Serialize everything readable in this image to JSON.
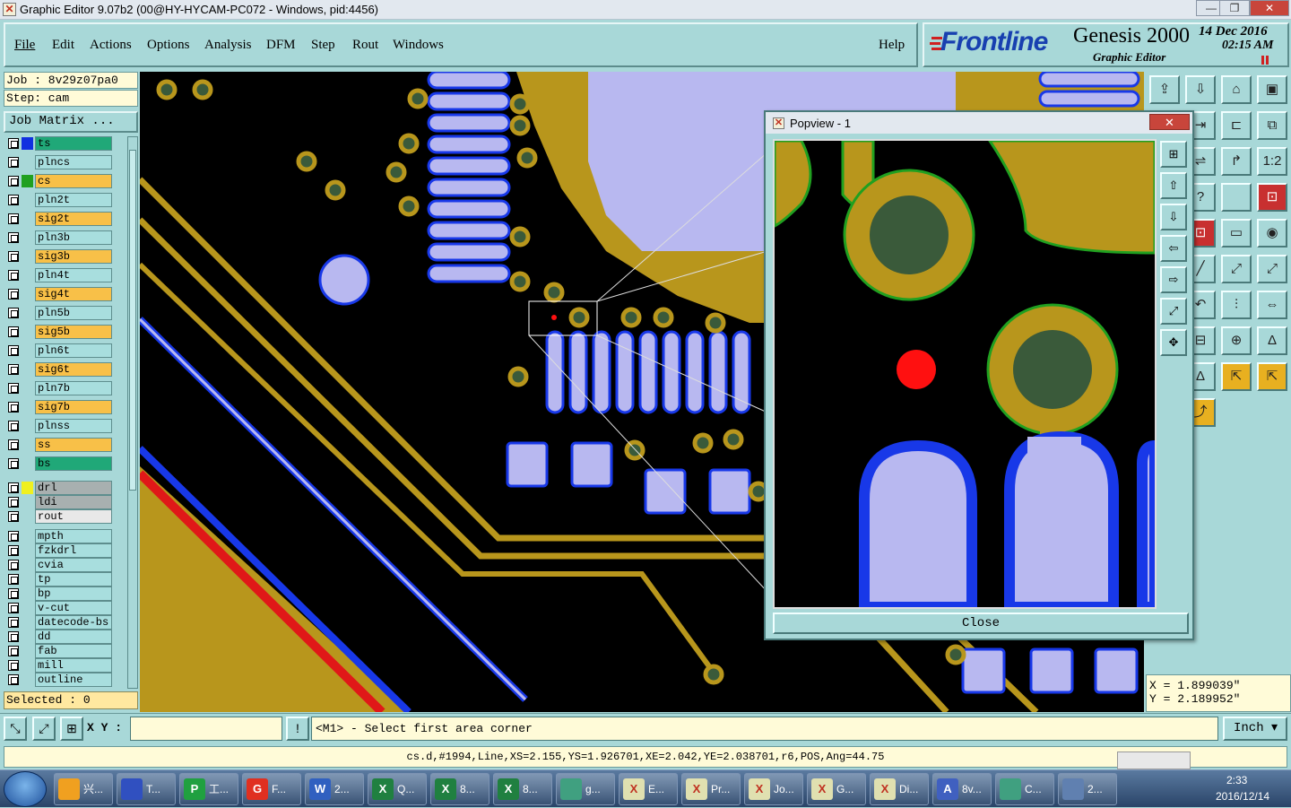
{
  "window": {
    "title": "Graphic Editor 9.07b2 (00@HY-HYCAM-PC072 - Windows, pid:4456)",
    "min": "—",
    "max": "❐",
    "close": "✕"
  },
  "menu": {
    "items": [
      "File",
      "Edit",
      "Actions",
      "Options",
      "Analysis",
      "DFM",
      "Step",
      "Rout",
      "Windows"
    ],
    "help": "Help"
  },
  "brand": {
    "logo": "Frontline",
    "product": "Genesis 2000",
    "subtitle": "Graphic Editor",
    "date": "14 Dec 2016",
    "time": "02:15 AM"
  },
  "job": {
    "job": "Job : 8v29z07pa0",
    "step": "Step: cam",
    "matrix_button": "Job Matrix ..."
  },
  "layers": [
    {
      "name": "ts",
      "color": "#1030e0",
      "bg": "#20a878"
    },
    {
      "name": "plncs",
      "color": "",
      "bg": "#a8dede"
    },
    {
      "name": "cs",
      "color": "#20a020",
      "bg": "#f8c048"
    },
    {
      "name": "pln2t",
      "color": "",
      "bg": "#a8dede"
    },
    {
      "name": "sig2t",
      "color": "",
      "bg": "#f8c048"
    },
    {
      "name": "pln3b",
      "color": "",
      "bg": "#a8dede"
    },
    {
      "name": "sig3b",
      "color": "",
      "bg": "#f8c048"
    },
    {
      "name": "pln4t",
      "color": "",
      "bg": "#a8dede"
    },
    {
      "name": "sig4t",
      "color": "",
      "bg": "#f8c048"
    },
    {
      "name": "pln5b",
      "color": "",
      "bg": "#a8dede"
    },
    {
      "name": "sig5b",
      "color": "",
      "bg": "#f8c048"
    },
    {
      "name": "pln6t",
      "color": "",
      "bg": "#a8dede"
    },
    {
      "name": "sig6t",
      "color": "",
      "bg": "#f8c048"
    },
    {
      "name": "pln7b",
      "color": "",
      "bg": "#a8dede"
    },
    {
      "name": "sig7b",
      "color": "",
      "bg": "#f8c048"
    },
    {
      "name": "plnss",
      "color": "",
      "bg": "#a8dede"
    },
    {
      "name": "ss",
      "color": "",
      "bg": "#f8c048"
    },
    {
      "name": "bs",
      "color": "",
      "bg": "#20a878"
    },
    {
      "name": "drl",
      "color": "#f0f020",
      "bg": "#a8b0b0"
    },
    {
      "name": "ldi",
      "color": "",
      "bg": "#a8b0b0"
    },
    {
      "name": "rout",
      "color": "",
      "bg": "#e8e8e8"
    },
    {
      "name": "mpth",
      "color": "",
      "bg": "#a8dede"
    },
    {
      "name": "fzkdrl",
      "color": "",
      "bg": "#a8dede"
    },
    {
      "name": "cvia",
      "color": "",
      "bg": "#a8dede"
    },
    {
      "name": "tp",
      "color": "",
      "bg": "#a8dede"
    },
    {
      "name": "bp",
      "color": "",
      "bg": "#a8dede"
    },
    {
      "name": "v-cut",
      "color": "",
      "bg": "#a8dede"
    },
    {
      "name": "datecode-bs",
      "color": "",
      "bg": "#a8dede"
    },
    {
      "name": "dd",
      "color": "",
      "bg": "#a8dede"
    },
    {
      "name": "fab",
      "color": "",
      "bg": "#a8dede"
    },
    {
      "name": "mill",
      "color": "",
      "bg": "#a8dede"
    },
    {
      "name": "outline",
      "color": "",
      "bg": "#a8dede"
    }
  ],
  "selected": "Selected : 0",
  "popview": {
    "title": "Popview - 1",
    "close_x": "✕",
    "close_button": "Close"
  },
  "coords": {
    "x": "X = 1.899039\"",
    "y": "Y = 2.189952\""
  },
  "command": {
    "xy_label": "X Y :",
    "xy_value": "",
    "prompt": "<M1> - Select first area corner",
    "unit": "Inch"
  },
  "status": "cs.d,#1994,Line,XS=2.155,YS=1.926701,XE=2.042,YE=2.038701,r6,POS,Ang=44.75",
  "taskbar": {
    "items": [
      {
        "label": "兴...",
        "icon": "sun",
        "color": "#f0a020"
      },
      {
        "label": "T...",
        "icon": "floppy",
        "color": "#3050c0"
      },
      {
        "label": "工...",
        "icon": "P",
        "color": "#20a040"
      },
      {
        "label": "F...",
        "icon": "G",
        "color": "#e03020"
      },
      {
        "label": "2...",
        "icon": "W",
        "color": "#3060c0"
      },
      {
        "label": "Q...",
        "icon": "X",
        "color": "#208040"
      },
      {
        "label": "8...",
        "icon": "X",
        "color": "#208040"
      },
      {
        "label": "8...",
        "icon": "X",
        "color": "#208040"
      },
      {
        "label": "g...",
        "icon": "eye",
        "color": "#40a080"
      },
      {
        "label": "E...",
        "icon": "X",
        "color": "#e0e0b0"
      },
      {
        "label": "Pr...",
        "icon": "X",
        "color": "#e0e0b0"
      },
      {
        "label": "Jo...",
        "icon": "X",
        "color": "#e0e0b0"
      },
      {
        "label": "G...",
        "icon": "X",
        "color": "#e0e0b0"
      },
      {
        "label": "Di...",
        "icon": "X",
        "color": "#e0e0b0"
      },
      {
        "label": "8v...",
        "icon": "A",
        "color": "#4060c0"
      },
      {
        "label": "C...",
        "icon": "eye",
        "color": "#40a080"
      },
      {
        "label": "2...",
        "icon": "img",
        "color": "#6080b0"
      }
    ],
    "time": "2:33",
    "date": "2016/12/14"
  }
}
